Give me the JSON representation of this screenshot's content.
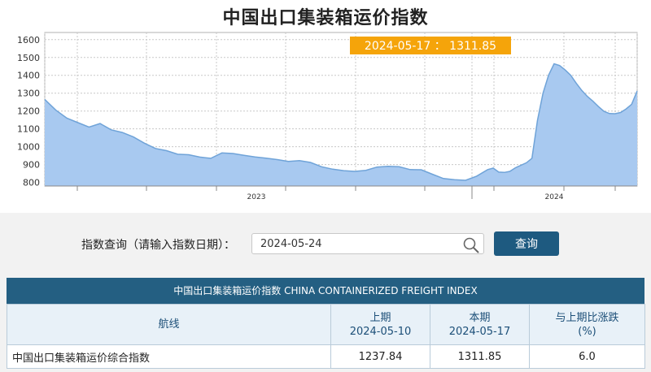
{
  "page_title": "中国出口集装箱运价指数",
  "chart_data": {
    "type": "area",
    "title": "中国出口集装箱运价指数",
    "xlabel": "",
    "ylabel": "",
    "ylim": [
      780,
      1640
    ],
    "yticks": [
      800,
      900,
      1000,
      1100,
      1200,
      1300,
      1400,
      1500,
      1600
    ],
    "xlim": [
      "2022-06-24",
      "2024-05-17"
    ],
    "xtick_labels": [
      {
        "date": "2023-01-01",
        "label": "2023"
      },
      {
        "date": "2024-01-01",
        "label": "2024"
      }
    ],
    "grid": true,
    "series": [
      {
        "fill_color": "#a8c9f0",
        "line_color": "#6fa3d8",
        "points": [
          [
            "2022-06-24",
            1265
          ],
          [
            "2022-07-08",
            1205
          ],
          [
            "2022-07-22",
            1160
          ],
          [
            "2022-08-05",
            1135
          ],
          [
            "2022-08-19",
            1110
          ],
          [
            "2022-09-02",
            1130
          ],
          [
            "2022-09-16",
            1095
          ],
          [
            "2022-09-30",
            1080
          ],
          [
            "2022-10-14",
            1055
          ],
          [
            "2022-10-28",
            1020
          ],
          [
            "2022-11-11",
            990
          ],
          [
            "2022-11-25",
            978
          ],
          [
            "2022-12-09",
            958
          ],
          [
            "2022-12-23",
            955
          ],
          [
            "2023-01-06",
            942
          ],
          [
            "2023-01-20",
            935
          ],
          [
            "2023-02-03",
            965
          ],
          [
            "2023-02-17",
            962
          ],
          [
            "2023-03-03",
            952
          ],
          [
            "2023-03-17",
            943
          ],
          [
            "2023-03-31",
            936
          ],
          [
            "2023-04-14",
            928
          ],
          [
            "2023-04-28",
            918
          ],
          [
            "2023-05-12",
            922
          ],
          [
            "2023-05-26",
            912
          ],
          [
            "2023-06-09",
            888
          ],
          [
            "2023-06-23",
            874
          ],
          [
            "2023-07-07",
            866
          ],
          [
            "2023-07-21",
            862
          ],
          [
            "2023-08-04",
            868
          ],
          [
            "2023-08-18",
            886
          ],
          [
            "2023-09-01",
            890
          ],
          [
            "2023-09-15",
            888
          ],
          [
            "2023-09-29",
            872
          ],
          [
            "2023-10-13",
            871
          ],
          [
            "2023-10-27",
            846
          ],
          [
            "2023-11-10",
            822
          ],
          [
            "2023-11-24",
            815
          ],
          [
            "2023-12-08",
            812
          ],
          [
            "2023-12-22",
            835
          ],
          [
            "2024-01-05",
            872
          ],
          [
            "2024-01-12",
            880
          ],
          [
            "2024-01-19",
            858
          ],
          [
            "2024-01-26",
            856
          ],
          [
            "2024-02-02",
            862
          ],
          [
            "2024-02-09",
            882
          ],
          [
            "2024-02-23",
            910
          ],
          [
            "2024-03-01",
            935
          ],
          [
            "2024-03-08",
            1148
          ],
          [
            "2024-03-15",
            1300
          ],
          [
            "2024-03-22",
            1400
          ],
          [
            "2024-03-29",
            1465
          ],
          [
            "2024-04-05",
            1455
          ],
          [
            "2024-04-12",
            1430
          ],
          [
            "2024-04-19",
            1400
          ],
          [
            "2024-04-26",
            1355
          ],
          [
            "2024-05-03",
            1315
          ],
          [
            "2024-05-10",
            1282
          ],
          [
            "2024-05-17",
            1255
          ],
          [
            "2024-05-24",
            1225
          ],
          [
            "2024-05-31",
            1198
          ],
          [
            "2024-06-07",
            1186
          ],
          [
            "2024-06-14",
            1185
          ],
          [
            "2024-06-21",
            1192
          ],
          [
            "2024-06-28",
            1212
          ],
          [
            "2024-07-05",
            1237.84
          ],
          [
            "2024-07-12",
            1311.85
          ]
        ]
      }
    ],
    "tooltip": {
      "text": "2024-05-17 ： 1311.85",
      "bg_color": "#f5a40a"
    }
  },
  "query": {
    "label": "指数查询（请输入指数日期）：",
    "input_value": "2024-05-24",
    "button_label": "查询"
  },
  "table": {
    "caption": "中国出口集装箱运价指数 CHINA CONTAINERIZED FREIGHT INDEX",
    "headers": {
      "route": "航线",
      "prev_label": "上期",
      "prev_date": "2024-05-10",
      "curr_label": "本期",
      "curr_date": "2024-05-17",
      "change_label": "与上期比涨跌",
      "change_unit": "(%)"
    },
    "rows": [
      {
        "route": "中国出口集装箱运价综合指数",
        "prev": "1237.84",
        "curr": "1311.85",
        "change": "6.0"
      }
    ]
  },
  "colors": {
    "header_bar": "#245f82",
    "button": "#1e5a80",
    "tooltip": "#f5a40a"
  }
}
